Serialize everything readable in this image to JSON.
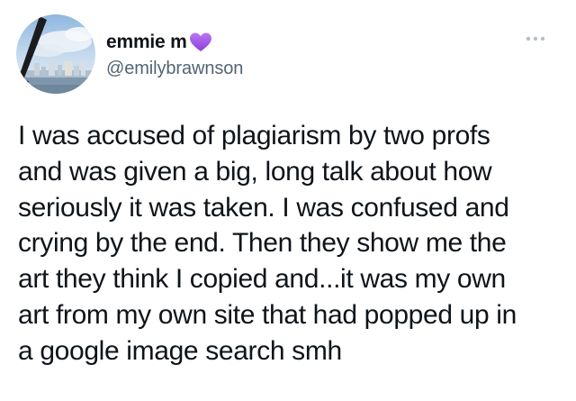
{
  "author": {
    "display_name": "emmie m",
    "handle": "@emilybrawnson",
    "badge_icon": "purple-heart-icon",
    "badge_color": "#a259e6"
  },
  "header": {
    "more_icon": "more-options-icon"
  },
  "tweet": {
    "text": "I was accused of plagiarism by two profs\nand was given a big, long talk about how\nseriously it was taken. I was confused and\ncrying by the end. Then they show me the\nart they think I copied and...it was my own\nart from my own site that had popped up in\na google image search smh"
  },
  "colors": {
    "text": "#0f1419",
    "secondary_text": "#536471",
    "more_icon": "#b7bec5"
  }
}
